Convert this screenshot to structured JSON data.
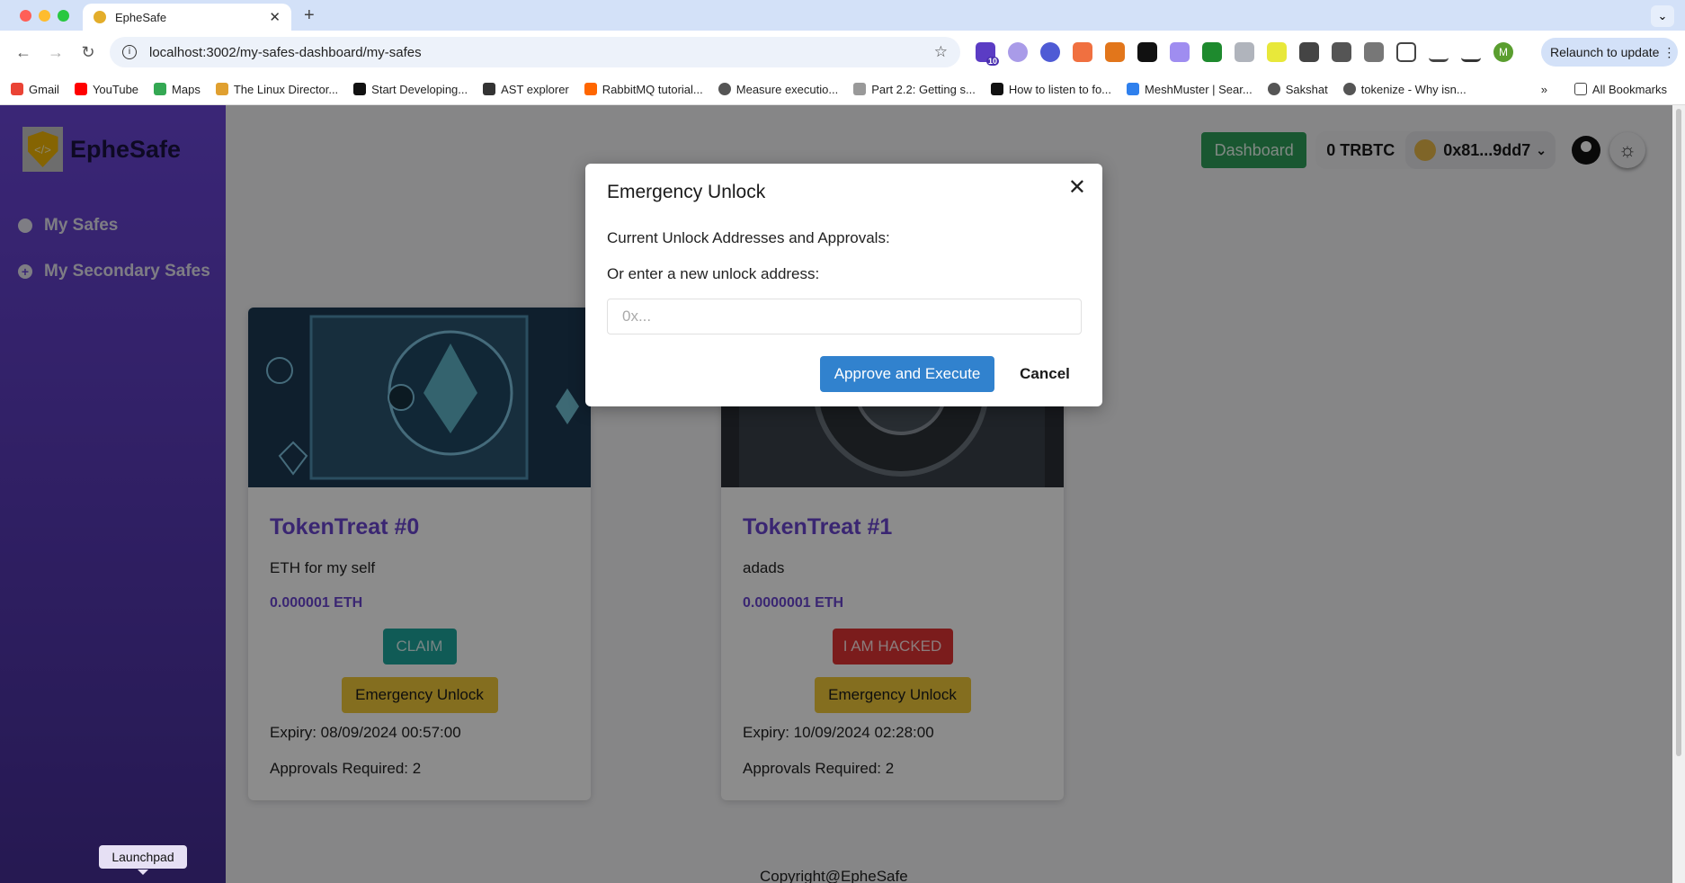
{
  "browser": {
    "tab_title": "EpheSafe",
    "url": "localhost:3002/my-safes-dashboard/my-safes",
    "relaunch_label": "Relaunch to update",
    "profile_initial": "M",
    "ext_badge": "10",
    "bookmarks": [
      {
        "label": "Gmail",
        "color": "#ea4335"
      },
      {
        "label": "YouTube",
        "color": "#ff0000"
      },
      {
        "label": "Maps",
        "color": "#34a853"
      },
      {
        "label": "The Linux Director...",
        "color": "#e0a030"
      },
      {
        "label": "Start Developing...",
        "color": "#111111"
      },
      {
        "label": "AST explorer",
        "color": "#333333"
      },
      {
        "label": "RabbitMQ tutorial...",
        "color": "#ff6600"
      },
      {
        "label": "Measure executio...",
        "color": "#555555"
      },
      {
        "label": "Part 2.2: Getting s...",
        "color": "#999999"
      },
      {
        "label": "How to listen to fo...",
        "color": "#111111"
      },
      {
        "label": "MeshMuster | Sear...",
        "color": "#2f80ed"
      },
      {
        "label": "Sakshat",
        "color": "#555555"
      },
      {
        "label": "tokenize - Why isn...",
        "color": "#555555"
      }
    ],
    "more_bookmarks": "»",
    "all_bookmarks": "All Bookmarks"
  },
  "sidebar": {
    "brand": "EpheSafe",
    "items": [
      {
        "label": "My Safes",
        "icon": "cookie-icon"
      },
      {
        "label": "My Secondary Safes",
        "icon": "plus-circle-icon"
      }
    ],
    "tooltip": "Launchpad"
  },
  "header": {
    "dashboard_label": "Dashboard",
    "balance": "0 TRBTC",
    "account": "0x81...9dd7"
  },
  "safes": [
    {
      "title": "TokenTreat #0",
      "description": "ETH for my self",
      "amount": "0.000001 ETH",
      "action": "CLAIM",
      "emergency": "Emergency Unlock",
      "expiry": "Expiry: 08/09/2024 00:57:00",
      "approvals": "Approvals Required: 2"
    },
    {
      "title": "TokenTreat #1",
      "description": "adads",
      "amount": "0.0000001 ETH",
      "action": "I AM HACKED",
      "emergency": "Emergency Unlock",
      "expiry": "Expiry: 10/09/2024 02:28:00",
      "approvals": "Approvals Required: 2"
    }
  ],
  "footer": "Copyright@EpheSafe",
  "modal": {
    "title": "Emergency Unlock",
    "current_label": "Current Unlock Addresses and Approvals:",
    "new_label": "Or enter a new unlock address:",
    "input_value": "",
    "input_placeholder": "0x...",
    "approve_label": "Approve and Execute",
    "cancel_label": "Cancel"
  },
  "colors": {
    "accent": "#6a45d0",
    "approve": "#3182ce",
    "claim": "#1ea79d",
    "hacked": "#e03434",
    "emergency": "#f0c93a",
    "dashboard": "#2f9e5a"
  }
}
